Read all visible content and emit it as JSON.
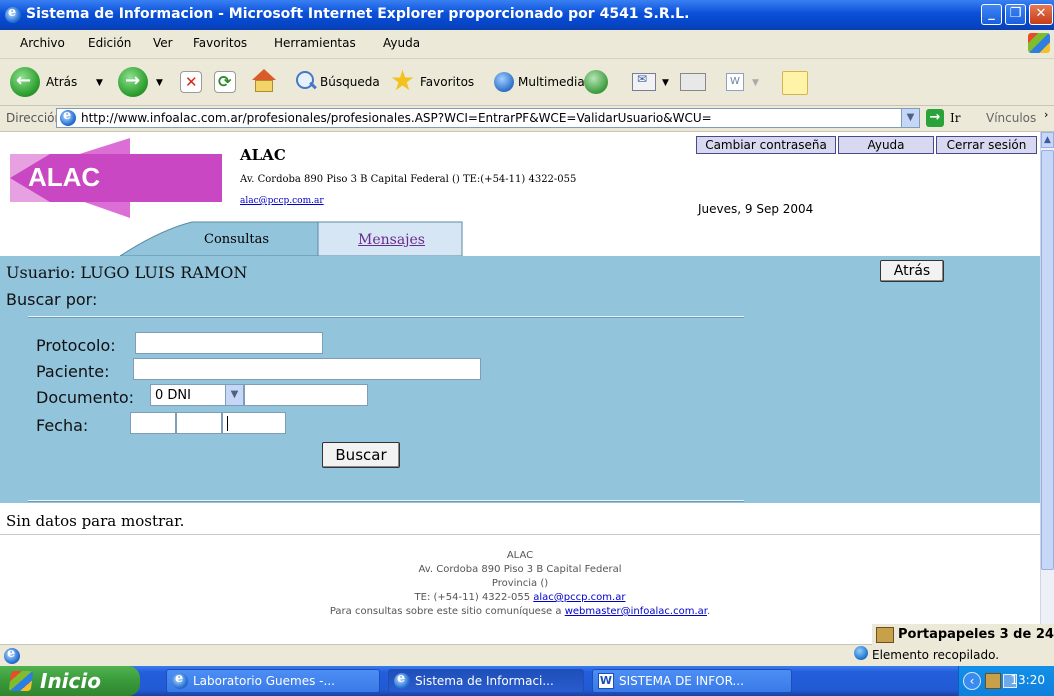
{
  "window": {
    "title": "Sistema de Informacion - Microsoft Internet Explorer proporcionado por 4541 S.R.L."
  },
  "menu": [
    "Archivo",
    "Edición",
    "Ver",
    "Favoritos",
    "Herramientas",
    "Ayuda"
  ],
  "toolbar": {
    "back": "Atrás",
    "search": "Búsqueda",
    "favorites": "Favoritos",
    "media": "Multimedia"
  },
  "address": {
    "label": "Dirección",
    "url": "http://www.infoalac.com.ar/profesionales/profesionales.ASP?WCI=EntrarPF&WCE=ValidarUsuario&WCU=",
    "go": "Ir",
    "links": "Vínculos"
  },
  "page": {
    "logo_text": "ALAC",
    "brand": "ALAC",
    "address": "Av. Cordoba 890 Piso 3 B Capital Federal () TE:(+54-11) 4322-055",
    "email": "alac@pccp.com.ar",
    "date": "Jueves, 9 Sep 2004",
    "nav": {
      "change_password": "Cambiar contraseña",
      "help": "Ayuda",
      "logout": "Cerrar sesión"
    },
    "tabs": {
      "consultas": "Consultas",
      "mensajes": "Mensajes"
    },
    "user_line": "Usuario: LUGO LUIS RAMON",
    "back_button": "Atrás",
    "search_by": "Buscar por:",
    "form": {
      "protocolo": "Protocolo:",
      "paciente": "Paciente:",
      "documento": "Documento:",
      "doc_type": "0 DNI",
      "fecha": "Fecha:",
      "search_button": "Buscar"
    },
    "no_data": "Sin datos para mostrar.",
    "footer": {
      "line1": "ALAC",
      "line2": "Av. Cordoba 890 Piso 3 B Capital Federal",
      "line3": "Provincia ()",
      "line4_prefix": "TE: (+54-11) 4322-055 ",
      "line4_link": "alac@pccp.com.ar",
      "line5_prefix": "Para consultas sobre este sitio comuníquese a ",
      "line5_link": "webmaster@infoalac.com.ar",
      "line5_suffix": "."
    }
  },
  "clipboard": {
    "title": "Portapapeles 3 de 24",
    "msg": "Elemento recopilado."
  },
  "taskbar": {
    "start": "Inicio",
    "tasks": [
      "Laboratorio Guemes -...",
      "Sistema de Informaci...",
      "SISTEMA DE INFOR..."
    ],
    "clock": "13:20"
  }
}
